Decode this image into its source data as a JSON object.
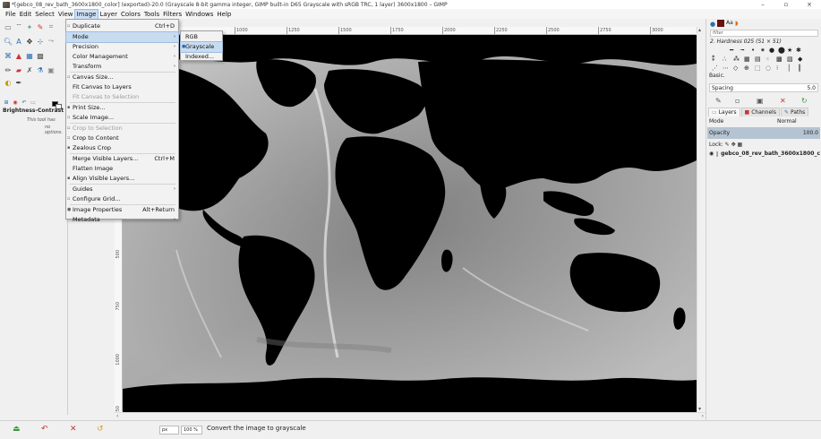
{
  "window": {
    "title": "*[gebco_08_rev_bath_3600x1800_color] (exported)-20.0 (Grayscale 8-bit gamma integer, GIMP built-in D65 Grayscale with sRGB TRC, 1 layer) 3600x1800 – GIMP",
    "minimize": "–",
    "maximize": "▫",
    "close": "×"
  },
  "menubar": [
    "File",
    "Edit",
    "Select",
    "View",
    "Image",
    "Layer",
    "Colors",
    "Tools",
    "Filters",
    "Windows",
    "Help"
  ],
  "toolbox": {
    "options_title": "Brightness-Contrast",
    "options_line1": "This tool has",
    "options_line2": "no options."
  },
  "image_menu": {
    "items": [
      {
        "label": "Duplicate",
        "shortcut": "Ctrl+D",
        "icon": "▫"
      },
      {
        "label": "Mode",
        "submenu": "›"
      },
      {
        "label": "Precision",
        "submenu": "›"
      },
      {
        "label": "Color Management",
        "submenu": "›"
      },
      {
        "label": "Transform",
        "submenu": "›"
      },
      {
        "label": "Canvas Size...",
        "icon": "▫"
      },
      {
        "label": "Fit Canvas to Layers"
      },
      {
        "label": "Fit Canvas to Selection"
      },
      {
        "label": "Print Size...",
        "icon": "▪"
      },
      {
        "label": "Scale Image...",
        "icon": "▫"
      },
      {
        "label": "Crop to Selection",
        "icon": "▫"
      },
      {
        "label": "Crop to Content",
        "icon": "▫"
      },
      {
        "label": "Zealous Crop",
        "icon": "▪"
      },
      {
        "label": "Merge Visible Layers...",
        "shortcut": "Ctrl+M"
      },
      {
        "label": "Flatten Image"
      },
      {
        "label": "Align Visible Layers...",
        "icon": "▪"
      },
      {
        "label": "Guides",
        "submenu": "›"
      },
      {
        "label": "Configure Grid...",
        "icon": "▫"
      },
      {
        "label": "Image Properties",
        "shortcut": "Alt+Return",
        "icon": "●"
      },
      {
        "label": "Metadata",
        "submenu": "›"
      }
    ]
  },
  "mode_menu": {
    "items": [
      {
        "label": "RGB"
      },
      {
        "label": "Grayscale",
        "icon": "●"
      },
      {
        "label": "Indexed..."
      }
    ]
  },
  "ruler": {
    "top": [
      "1000",
      "1250",
      "1500",
      "1750",
      "2000",
      "2250",
      "2500",
      "2750",
      "3000"
    ],
    "left": [
      "500",
      "750",
      "1000",
      "1250"
    ]
  },
  "statusbar": {
    "unit": "px",
    "zoom": "100 %",
    "message": "Convert the image to grayscale"
  },
  "dock": {
    "brush_filter_placeholder": "filter",
    "brush_name": "2. Hardness 025 (51 × 51)",
    "preset_label": "Basic.",
    "spacing_label": "Spacing",
    "spacing_value": "5.0",
    "tabs": [
      "Layers",
      "Channels",
      "Paths"
    ],
    "mode_label": "Mode",
    "mode_value": "Normal",
    "opacity_label": "Opacity",
    "opacity_value": "100.0",
    "lock_label": "Lock:",
    "layer_name": "gebco_08_rev_bath_3600x1800_c"
  },
  "colors": {
    "menu_highlight": "#c8dcf0",
    "opacity_bar": "#b5c4d2",
    "canvas_bg": "#000000"
  }
}
